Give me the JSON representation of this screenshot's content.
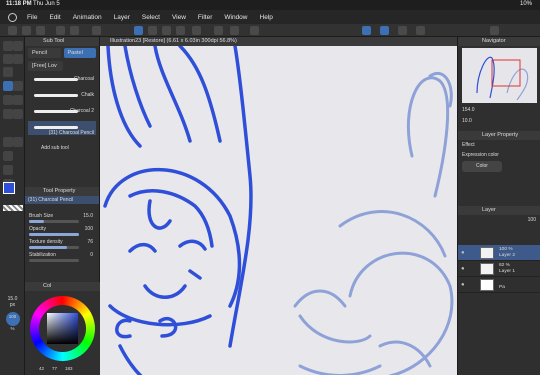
{
  "status": {
    "time": "11:18 PM",
    "date": "Thu Jun 5",
    "battery": "10%"
  },
  "menu": [
    "File",
    "Edit",
    "Animation",
    "Layer",
    "Select",
    "View",
    "Filter",
    "Window",
    "Help"
  ],
  "subtool": {
    "title": "Sub Tool",
    "tabs": [
      "Pencil",
      "Pastel"
    ],
    "group_label": "[Free] Lov",
    "brushes": [
      "Charcoal",
      "Chalk",
      "Charcoal 2",
      "(31) Charcoal Pencil"
    ],
    "add": "Add sub tool"
  },
  "toolprop": {
    "title": "Tool Property",
    "brush": "(31) Charcoal Pencil",
    "props": [
      {
        "label": "Brush Size",
        "value": "15.0",
        "level": 0.3
      },
      {
        "label": "Opacity",
        "value": "100",
        "level": 1.0
      },
      {
        "label": "Texture density",
        "value": "76",
        "level": 0.76
      },
      {
        "label": "Stabilization",
        "value": "0",
        "level": 0.0
      }
    ]
  },
  "leftcol": {
    "size": "15.0",
    "unit": "px",
    "opacity": "100",
    "opacity_unit": "%"
  },
  "color": {
    "title": "Col",
    "h": "42",
    "s": "77",
    "v": "183"
  },
  "canvas": {
    "title": "Illustration23 [Restore] (6.61 x 6.03in 300dpi 56.8%)"
  },
  "navigator": {
    "title": "Navigator",
    "zoom": "154.0",
    "angle": "10.0"
  },
  "layerprop": {
    "title": "Layer Property",
    "effect": "Effect",
    "expr": "Expression color",
    "color": "Color"
  },
  "layers": {
    "title": "Layer",
    "blend_value": "100",
    "items": [
      {
        "pct": "100 %",
        "name": "Layer 2",
        "selected": true
      },
      {
        "pct": "82 %",
        "name": "Layer 1",
        "selected": false
      },
      {
        "pct": "",
        "name": "Pa",
        "selected": false
      }
    ]
  },
  "colors": {
    "accent": "#3d6fb3",
    "line": "#2f4fd9",
    "sketch": "#8ea2d8"
  }
}
